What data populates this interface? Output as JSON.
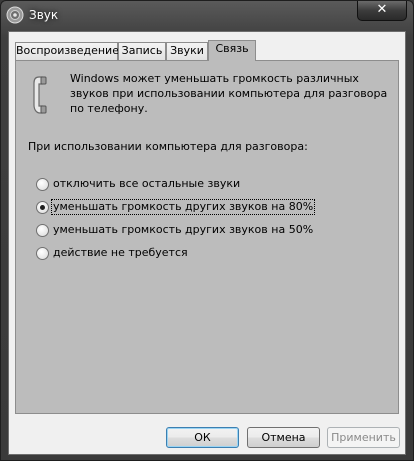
{
  "window": {
    "title": "Звук",
    "close_glyph": "✕"
  },
  "tabs": [
    {
      "label": "Воспроизведение",
      "active": false
    },
    {
      "label": "Запись",
      "active": false
    },
    {
      "label": "Звуки",
      "active": false
    },
    {
      "label": "Связь",
      "active": true
    }
  ],
  "communications": {
    "description": "Windows может уменьшать громкость различных звуков при использовании компьютера для разговора по телефону.",
    "prompt": "При использовании компьютера для разговора:",
    "options": [
      {
        "label": "отключить все остальные звуки",
        "checked": false
      },
      {
        "label": "уменьшать громкость других звуков на 80%",
        "checked": true
      },
      {
        "label": "уменьшать громкость других звуков на 50%",
        "checked": false
      },
      {
        "label": "действие не требуется",
        "checked": false
      }
    ]
  },
  "buttons": {
    "ok": "ОК",
    "cancel": "Отмена",
    "apply": "Применить"
  },
  "icons": {
    "app": "speaker-icon",
    "phone": "phone-icon"
  }
}
